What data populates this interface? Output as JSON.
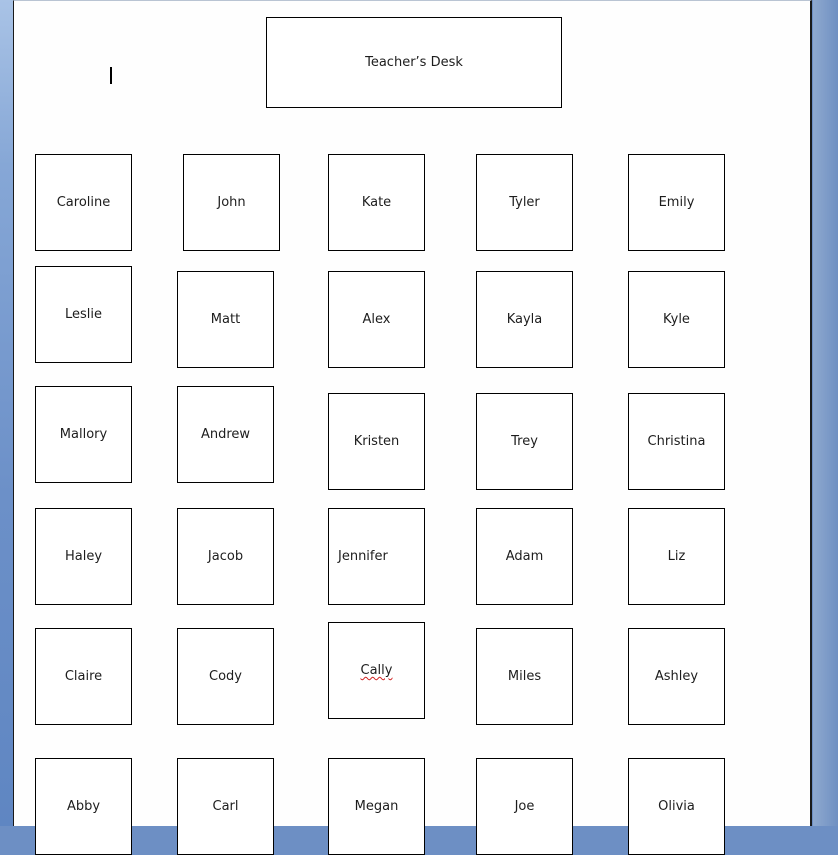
{
  "document": {
    "teacher_desk": "Teacher’s Desk",
    "seats": [
      {
        "name": "Caroline"
      },
      {
        "name": "John"
      },
      {
        "name": "Kate"
      },
      {
        "name": "Tyler"
      },
      {
        "name": "Emily"
      },
      {
        "name": "Leslie"
      },
      {
        "name": "Matt"
      },
      {
        "name": "Alex"
      },
      {
        "name": "Kayla"
      },
      {
        "name": "Kyle"
      },
      {
        "name": "Mallory"
      },
      {
        "name": "Andrew"
      },
      {
        "name": "Kristen"
      },
      {
        "name": "Trey"
      },
      {
        "name": "Christina"
      },
      {
        "name": "Haley"
      },
      {
        "name": "Jacob"
      },
      {
        "name": "Jennifer"
      },
      {
        "name": "Adam"
      },
      {
        "name": "Liz"
      },
      {
        "name": "Claire"
      },
      {
        "name": "Cody"
      },
      {
        "name": "Cally",
        "spelling_flag": true
      },
      {
        "name": "Miles"
      },
      {
        "name": "Ashley"
      },
      {
        "name": "Abby"
      },
      {
        "name": "Carl"
      },
      {
        "name": "Megan"
      },
      {
        "name": "Joe"
      },
      {
        "name": "Olivia"
      }
    ]
  }
}
